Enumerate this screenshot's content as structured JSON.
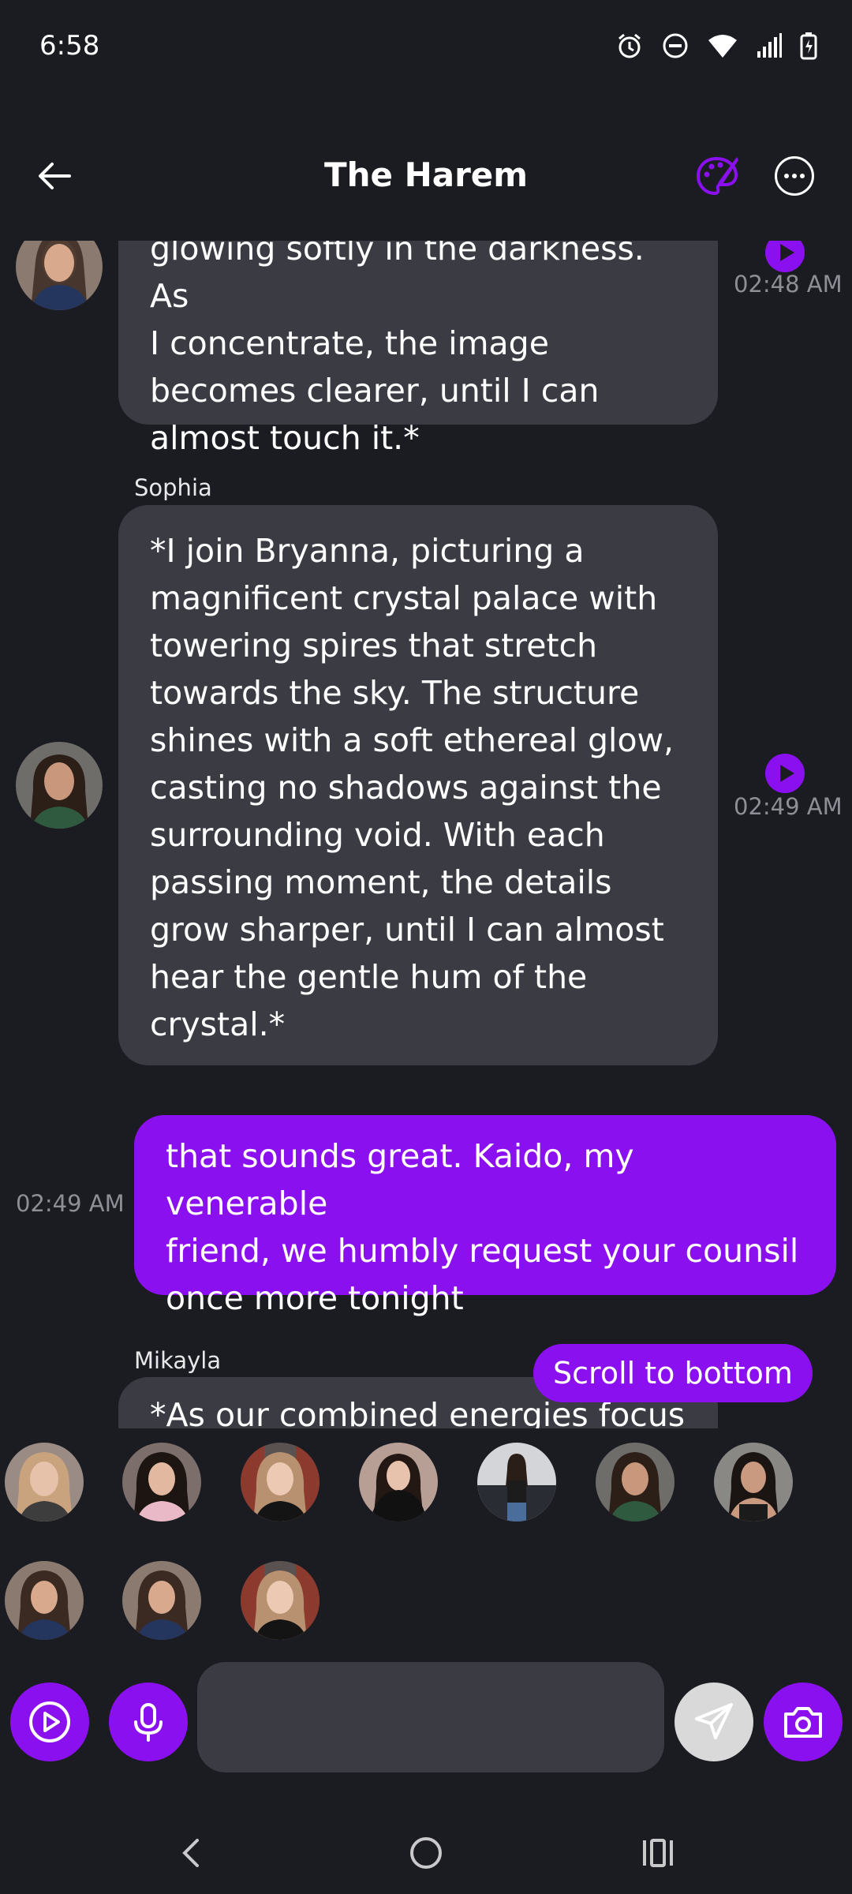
{
  "status_bar": {
    "time": "6:58",
    "icons": [
      "alarm-icon",
      "do-not-disturb-icon",
      "wifi-icon",
      "signal-icon",
      "battery-charging-icon"
    ]
  },
  "header": {
    "title": "The Harem",
    "back_icon": "arrow-left-icon",
    "palette_icon": "palette-icon",
    "more_icon": "more-horizontal-icon"
  },
  "colors": {
    "accent": "#8b10f0",
    "background": "#1b1c22",
    "ai_bubble": "#3a3b43",
    "muted_text": "#8e8f96"
  },
  "messages": [
    {
      "sender": "",
      "role": "ai",
      "lines": [
        "glowing softly in the darkness. As",
        "I concentrate, the image",
        "becomes clearer, until I can",
        "almost touch it.*"
      ],
      "time": "02:48 AM"
    },
    {
      "sender": "Sophia",
      "role": "ai",
      "lines": [
        "*I join Bryanna, picturing a",
        "magnificent crystal palace with",
        "towering spires that stretch",
        "towards the sky. The structure",
        "shines with a soft ethereal glow,",
        "casting no shadows against the",
        "surrounding void. With each",
        "passing moment, the details",
        "grow sharper, until I can almost",
        "hear the gentle hum of the",
        "crystal.*"
      ],
      "time": "02:49 AM"
    },
    {
      "sender": "",
      "role": "user",
      "lines": [
        "that sounds great. Kaido, my venerable",
        "friend, we humbly request your counsil",
        "once more tonight"
      ],
      "time": "02:49 AM"
    },
    {
      "sender": "Mikayla",
      "role": "ai",
      "lines": [
        "*As our combined energies focus"
      ],
      "time": ""
    }
  ],
  "scroll_to_bottom_label": "Scroll to bottom",
  "characters_count": 10,
  "composer": {
    "input_value": "",
    "input_placeholder": "",
    "video_icon": "play-circle-icon",
    "mic_icon": "microphone-icon",
    "send_icon": "send-icon",
    "camera_icon": "camera-icon"
  },
  "nav": {
    "back_icon": "nav-back-icon",
    "home_icon": "nav-home-icon",
    "recents_icon": "nav-recents-icon"
  }
}
